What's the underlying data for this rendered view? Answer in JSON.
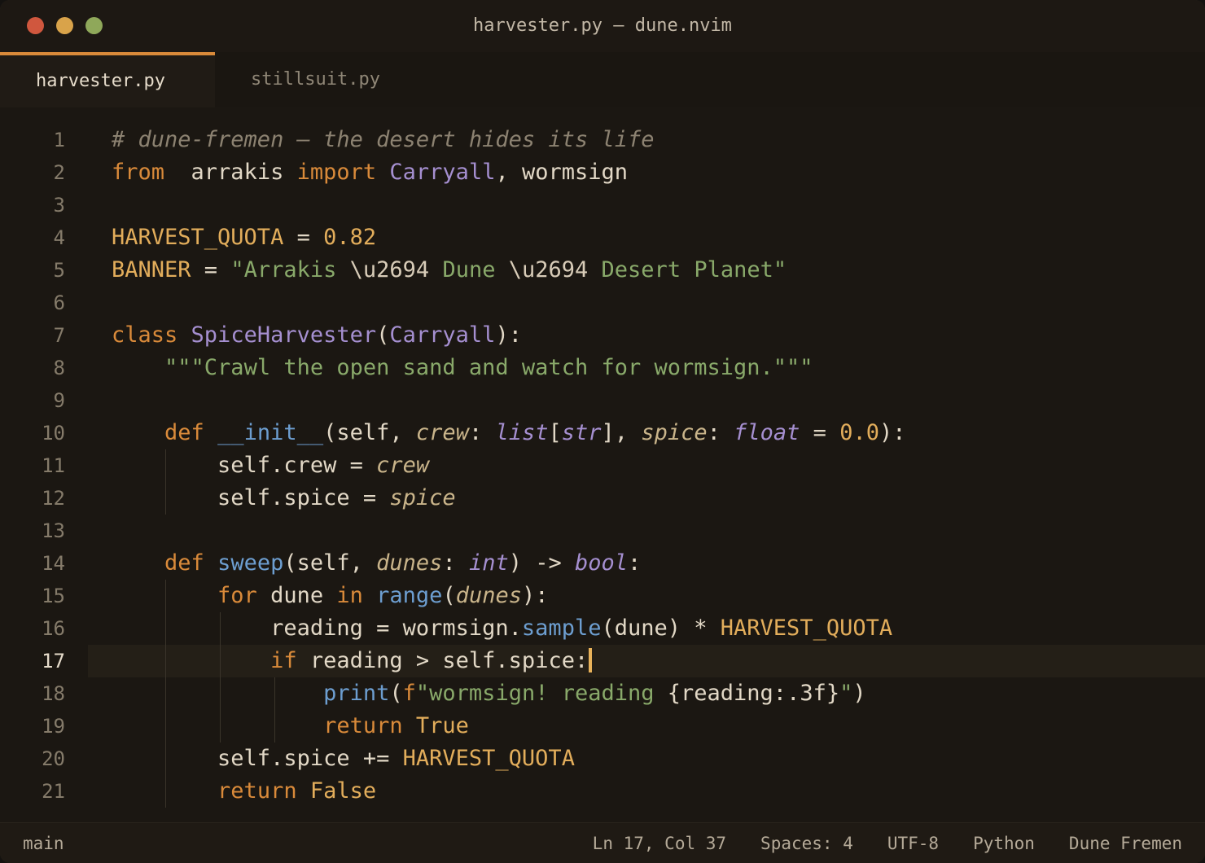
{
  "window": {
    "title": "harvester.py — dune.nvim",
    "traffic_lights": {
      "close": "#d0573e",
      "minimize": "#d9a34a",
      "zoom": "#8fa85a"
    }
  },
  "tabs": [
    {
      "label": "harvester.py",
      "active": true
    },
    {
      "label": "stillsuit.py",
      "active": false
    }
  ],
  "colors": {
    "accent": "#d98a3a",
    "background": "#1b1712",
    "comment": "#8c8271",
    "keyword": "#d98a3a",
    "class": "#a58fd0",
    "function": "#6d9ed0",
    "string": "#89a96a",
    "number": "#e2ad5b"
  },
  "editor": {
    "current_line": 17,
    "line_numbers": [
      "1",
      "2",
      "3",
      "4",
      "5",
      "6",
      "7",
      "8",
      "9",
      "10",
      "11",
      "12",
      "13",
      "14",
      "15",
      "16",
      "17",
      "18",
      "19",
      "20",
      "21"
    ],
    "lines": [
      [
        [
          "c-com",
          "# dune-fremen — the desert hides its life"
        ]
      ],
      [
        [
          "c-kw",
          "from"
        ],
        [
          "",
          "  arrakis "
        ],
        [
          "c-kw",
          "import"
        ],
        [
          "",
          " "
        ],
        [
          "c-cls",
          "Carryall"
        ],
        [
          "",
          ", wormsign"
        ]
      ],
      [],
      [
        [
          "c-const",
          "HARVEST_QUOTA"
        ],
        [
          "",
          " = "
        ],
        [
          "c-num",
          "0.82"
        ]
      ],
      [
        [
          "c-const",
          "BANNER"
        ],
        [
          "",
          " = "
        ],
        [
          "c-str",
          "\"Arrakis "
        ],
        [
          "c-esc",
          "\\u2694"
        ],
        [
          "c-str",
          " Dune "
        ],
        [
          "c-esc",
          "\\u2694"
        ],
        [
          "c-str",
          " Desert Planet\""
        ]
      ],
      [],
      [
        [
          "c-kw",
          "class"
        ],
        [
          "",
          " "
        ],
        [
          "c-cls",
          "SpiceHarvester"
        ],
        [
          "",
          "("
        ],
        [
          "c-cls",
          "Carryall"
        ],
        [
          "",
          "):"
        ]
      ],
      [
        [
          "",
          "    "
        ],
        [
          "c-str",
          "\"\"\"Crawl the open sand and watch for wormsign.\"\"\""
        ]
      ],
      [],
      [
        [
          "",
          "    "
        ],
        [
          "c-kw",
          "def"
        ],
        [
          "",
          " "
        ],
        [
          "c-fn",
          "__init__"
        ],
        [
          "",
          "(self, "
        ],
        [
          "c-param",
          "crew"
        ],
        [
          "",
          ": "
        ],
        [
          "c-type",
          "list"
        ],
        [
          "",
          "["
        ],
        [
          "c-type",
          "str"
        ],
        [
          "",
          "], "
        ],
        [
          "c-param",
          "spice"
        ],
        [
          "",
          ": "
        ],
        [
          "c-type",
          "float"
        ],
        [
          "",
          " = "
        ],
        [
          "c-num",
          "0.0"
        ],
        [
          "",
          "):"
        ]
      ],
      [
        [
          "",
          "        self.crew = "
        ],
        [
          "c-param",
          "crew"
        ]
      ],
      [
        [
          "",
          "        self.spice = "
        ],
        [
          "c-param",
          "spice"
        ]
      ],
      [],
      [
        [
          "",
          "    "
        ],
        [
          "c-kw",
          "def"
        ],
        [
          "",
          " "
        ],
        [
          "c-fn",
          "sweep"
        ],
        [
          "",
          "(self, "
        ],
        [
          "c-param",
          "dunes"
        ],
        [
          "",
          ": "
        ],
        [
          "c-type",
          "int"
        ],
        [
          "",
          ") -> "
        ],
        [
          "c-type",
          "bool"
        ],
        [
          "",
          ":"
        ]
      ],
      [
        [
          "",
          "        "
        ],
        [
          "c-kw",
          "for"
        ],
        [
          "",
          " dune "
        ],
        [
          "c-kw",
          "in"
        ],
        [
          "",
          " "
        ],
        [
          "c-fn",
          "range"
        ],
        [
          "",
          "("
        ],
        [
          "c-param",
          "dunes"
        ],
        [
          "",
          "):"
        ]
      ],
      [
        [
          "",
          "            reading = wormsign."
        ],
        [
          "c-fn",
          "sample"
        ],
        [
          "",
          "(dune) * "
        ],
        [
          "c-const",
          "HARVEST_QUOTA"
        ]
      ],
      [
        [
          "",
          "            "
        ],
        [
          "c-kw",
          "if"
        ],
        [
          "",
          " reading > self.spice:"
        ]
      ],
      [
        [
          "",
          "                "
        ],
        [
          "c-fn",
          "print"
        ],
        [
          "",
          "("
        ],
        [
          "c-kw",
          "f"
        ],
        [
          "c-str",
          "\"wormsign! reading "
        ],
        [
          "",
          "{reading:.3f}"
        ],
        [
          "c-str",
          "\""
        ],
        [
          "",
          ")"
        ]
      ],
      [
        [
          "",
          "                "
        ],
        [
          "c-kw",
          "return"
        ],
        [
          "",
          " "
        ],
        [
          "c-const",
          "True"
        ]
      ],
      [
        [
          "",
          "        self.spice += "
        ],
        [
          "c-const",
          "HARVEST_QUOTA"
        ]
      ],
      [
        [
          "",
          "        "
        ],
        [
          "c-kw",
          "return"
        ],
        [
          "",
          " "
        ],
        [
          "c-const",
          "False"
        ]
      ]
    ]
  },
  "status": {
    "branch": "main",
    "position": "Ln 17, Col 37",
    "indent": "Spaces: 4",
    "encoding": "UTF-8",
    "language": "Python",
    "theme": "Dune Fremen"
  }
}
